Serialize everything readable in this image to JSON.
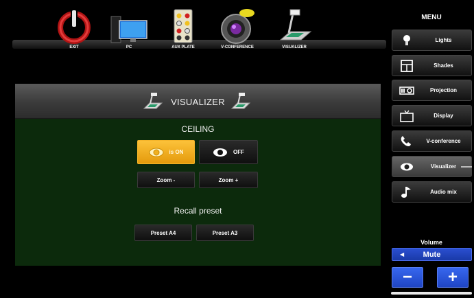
{
  "sources": [
    {
      "id": "exit",
      "label": "EXIT",
      "icon": "power-icon"
    },
    {
      "id": "pc",
      "label": "PC",
      "icon": "pc-icon"
    },
    {
      "id": "aux",
      "label": "AUX PLATE",
      "icon": "aux-plate-icon"
    },
    {
      "id": "vconf",
      "label": "V-CONFERENCE",
      "icon": "camera-icon"
    },
    {
      "id": "visualizer",
      "label": "VISUALIZER",
      "icon": "visualizer-icon"
    }
  ],
  "panel": {
    "title": "VISUALIZER",
    "ceiling": {
      "heading": "CEILING",
      "on_label": "is ON",
      "off_label": "OFF",
      "zoom_minus": "Zoom -",
      "zoom_plus": "Zoom +",
      "state": "on"
    },
    "preset": {
      "heading": "Recall preset",
      "a4": "Preset A4",
      "a3": "Preset A3"
    }
  },
  "menu": {
    "title": "MENU",
    "items": [
      {
        "label": "Lights",
        "icon": "bulb-icon"
      },
      {
        "label": "Shades",
        "icon": "window-icon"
      },
      {
        "label": "Projection",
        "icon": "projector-icon"
      },
      {
        "label": "Display",
        "icon": "tv-icon"
      },
      {
        "label": "V-conference",
        "icon": "phone-icon"
      },
      {
        "label": "Visualizer",
        "icon": "eye-icon"
      },
      {
        "label": "Audio mix",
        "icon": "music-note-icon"
      }
    ],
    "selected": "Visualizer"
  },
  "volume": {
    "title": "Volume",
    "mute_label": "Mute",
    "minus_label": "−",
    "plus_label": "+"
  },
  "colors": {
    "panel_bg": "#0c2a0c",
    "active_yellow": "#f5b52a",
    "volume_blue": "#2a55e0"
  }
}
